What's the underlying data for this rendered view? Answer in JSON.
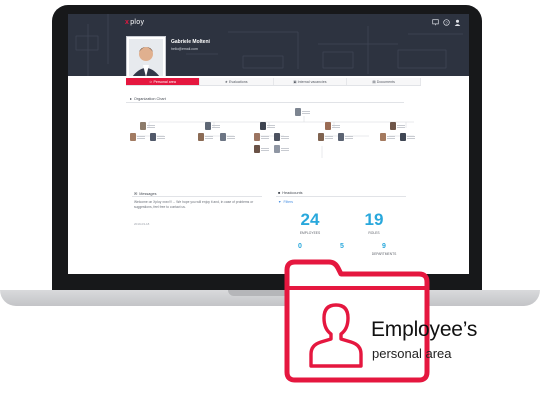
{
  "app": {
    "logo_mark": "x",
    "logo_text": "ploy"
  },
  "header": {
    "icons": [
      "monitor-icon",
      "help-icon",
      "user-icon"
    ]
  },
  "user": {
    "name": "Gabriele Molteni",
    "email": "hello@email.com"
  },
  "tabs": [
    {
      "label": "Personal area",
      "icon": "user-icon",
      "active": true
    },
    {
      "label": "Evaluations",
      "icon": "star-icon",
      "active": false
    },
    {
      "label": "Internal vacancies",
      "icon": "briefcase-icon",
      "active": false
    },
    {
      "label": "Documents",
      "icon": "document-icon",
      "active": false
    }
  ],
  "org_chart": {
    "title": "Organization Chart"
  },
  "messages": {
    "title": "Messages",
    "body": "Welcome on Xploy xxxx!!! ... We hope you will enjoy it and, in case of problems or suggestions, feel free to contact us.",
    "date": "2019-03-18"
  },
  "headcount": {
    "title": "Headcounts",
    "filters_label": "Filters",
    "employees_value": "24",
    "employees_label": "EMPLOYEES",
    "roles_value": "19",
    "roles_label": "ROLES",
    "stat_a_value": "0",
    "stat_b_value": "5",
    "departments_value": "9",
    "departments_label": "DEPARTMENTS"
  },
  "overlay": {
    "title": "Employee’s",
    "subtitle": "personal area",
    "icon": "user-folder-icon",
    "accent": "#e5173f"
  },
  "colors": {
    "header_bg": "#2d3340",
    "accent": "#e5173f",
    "stat_blue": "#29a8dc"
  }
}
